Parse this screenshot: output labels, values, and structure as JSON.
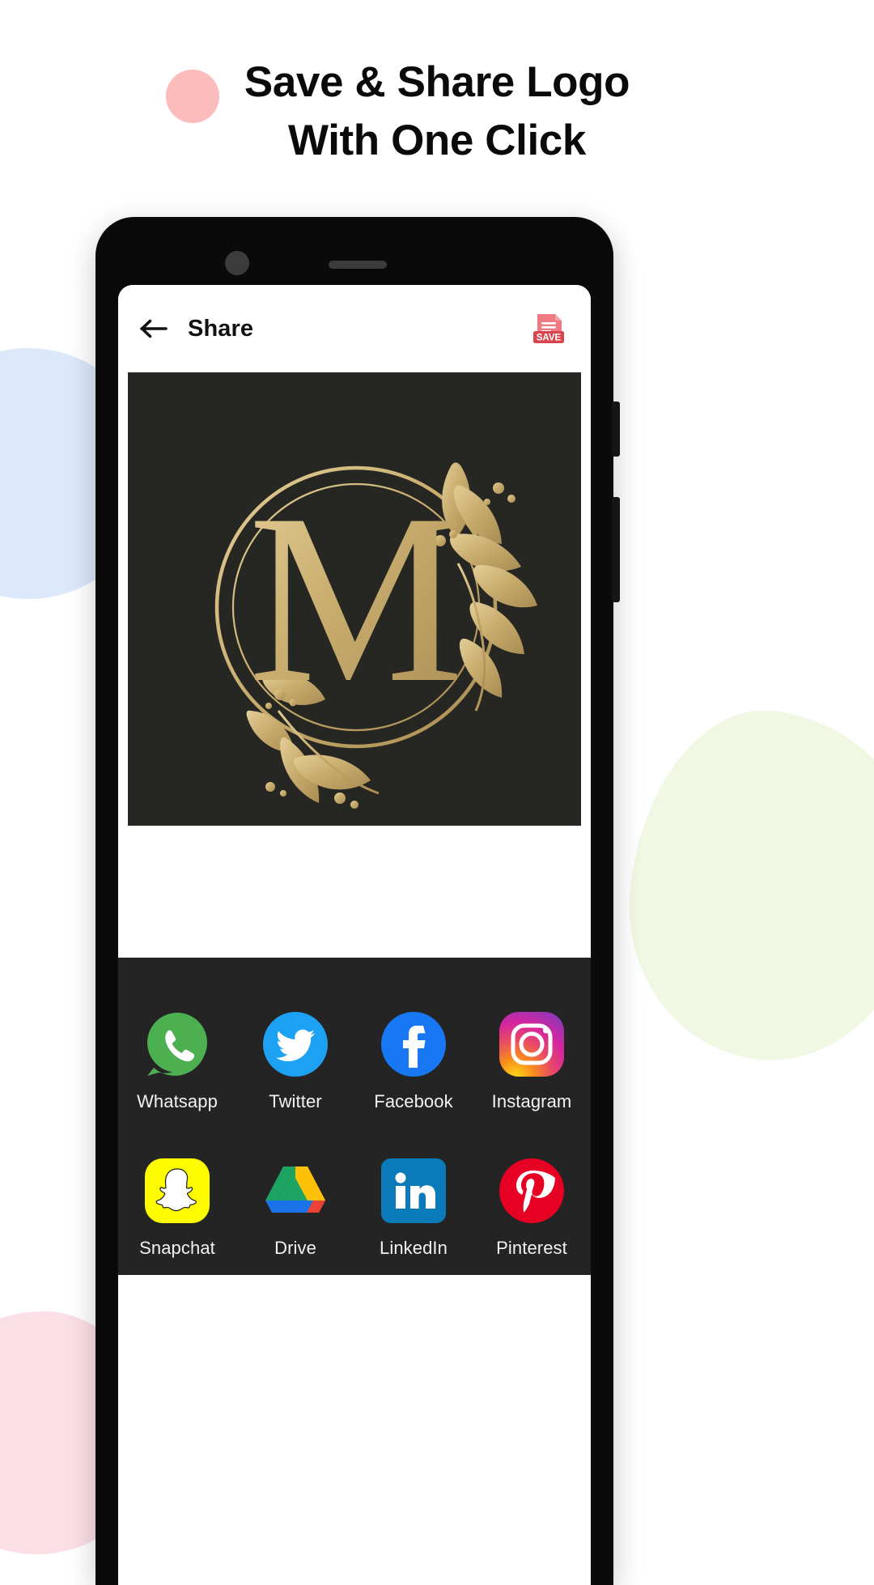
{
  "headline": {
    "line1": "Save & Share Logo",
    "line2": "With One Click"
  },
  "colors": {
    "pink_accent": "#fcbcbc",
    "blob_blue": "#dbe9fb",
    "blob_green": "#f0f8e4",
    "blob_pink": "#fcdfe6",
    "phone_body": "#0a0a0a",
    "share_sheet_bg": "#242424",
    "logo_bg": "#262622",
    "logo_gold": "#c9ad6f",
    "save_red": "#e8616b"
  },
  "appbar": {
    "back_icon": "arrow-left-icon",
    "title": "Share",
    "save_icon": "save-file-icon",
    "save_icon_label": "SAVE"
  },
  "preview": {
    "logo_letter": "M",
    "logo_description": "gold monogram letter M inside an ornate floral circular wreath",
    "background_color": "#262622",
    "gold_color": "#c9ad6f"
  },
  "share_sheet": {
    "apps": [
      {
        "label": "Whatsapp",
        "icon": "whatsapp-icon",
        "color": "#4caf50"
      },
      {
        "label": "Twitter",
        "icon": "twitter-icon",
        "color": "#1da1f2"
      },
      {
        "label": "Facebook",
        "icon": "facebook-icon",
        "color": "#1877f2"
      },
      {
        "label": "Instagram",
        "icon": "instagram-icon",
        "color": "#d6249f"
      },
      {
        "label": "Snapchat",
        "icon": "snapchat-icon",
        "color": "#fffc00"
      },
      {
        "label": "Drive",
        "icon": "google-drive-icon",
        "color": "#1da462"
      },
      {
        "label": "LinkedIn",
        "icon": "linkedin-icon",
        "color": "#0a7bb8"
      },
      {
        "label": "Pinterest",
        "icon": "pinterest-icon",
        "color": "#e60023"
      }
    ]
  },
  "phone": {
    "camera": "front-camera",
    "speaker": "earpiece-speaker"
  }
}
